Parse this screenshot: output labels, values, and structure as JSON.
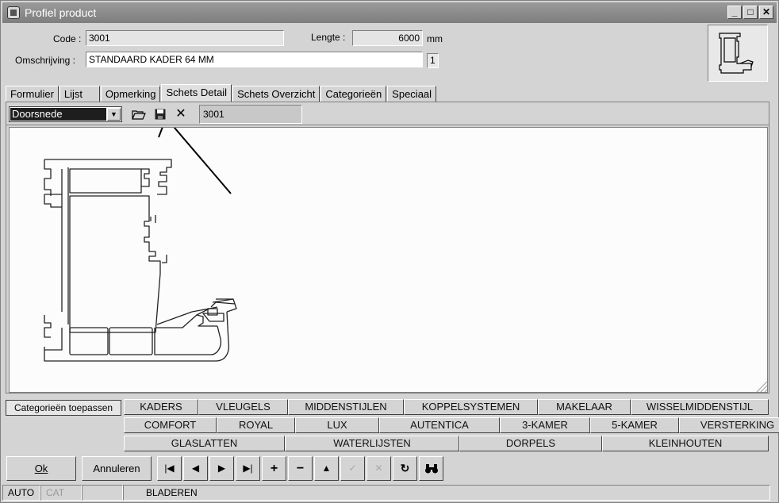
{
  "window": {
    "title": "Profiel product",
    "buttons": {
      "minimize": "_",
      "maximize": "□",
      "close": "✕"
    }
  },
  "form": {
    "code_label": "Code :",
    "code_value": "3001",
    "length_label": "Lengte :",
    "length_value": "6000",
    "length_unit": "mm",
    "description_label": "Omschrijving :",
    "description_value": "STANDAARD KADER 64 MM",
    "counter": "1"
  },
  "tabs": [
    {
      "label": "Formulier"
    },
    {
      "label": "Lijst"
    },
    {
      "label": "Opmerking"
    },
    {
      "label": "Schets Detail"
    },
    {
      "label": "Schets Overzicht"
    },
    {
      "label": "Categorieën"
    },
    {
      "label": "Speciaal"
    }
  ],
  "sketch_toolbar": {
    "view_select": "Doorsnede",
    "code": "3001"
  },
  "categories": {
    "apply_label": "Categorieën toepassen",
    "row1": [
      "KADERS",
      "VLEUGELS",
      "MIDDENSTIJLEN",
      "KOPPELSYSTEMEN",
      "MAKELAAR",
      "WISSELMIDDENSTIJL"
    ],
    "row2": [
      "COMFORT",
      "ROYAL",
      "LUX",
      "AUTENTICA",
      "3-KAMER",
      "5-KAMER",
      "VERSTERKING"
    ],
    "row3": [
      "GLASLATTEN",
      "WATERLIJSTEN",
      "DORPELS",
      "KLEINHOUTEN"
    ]
  },
  "actions": {
    "ok": "Ok",
    "cancel": "Annuleren"
  },
  "status": {
    "mode": "AUTO",
    "cat": "CAT",
    "state": "BLADEREN"
  }
}
